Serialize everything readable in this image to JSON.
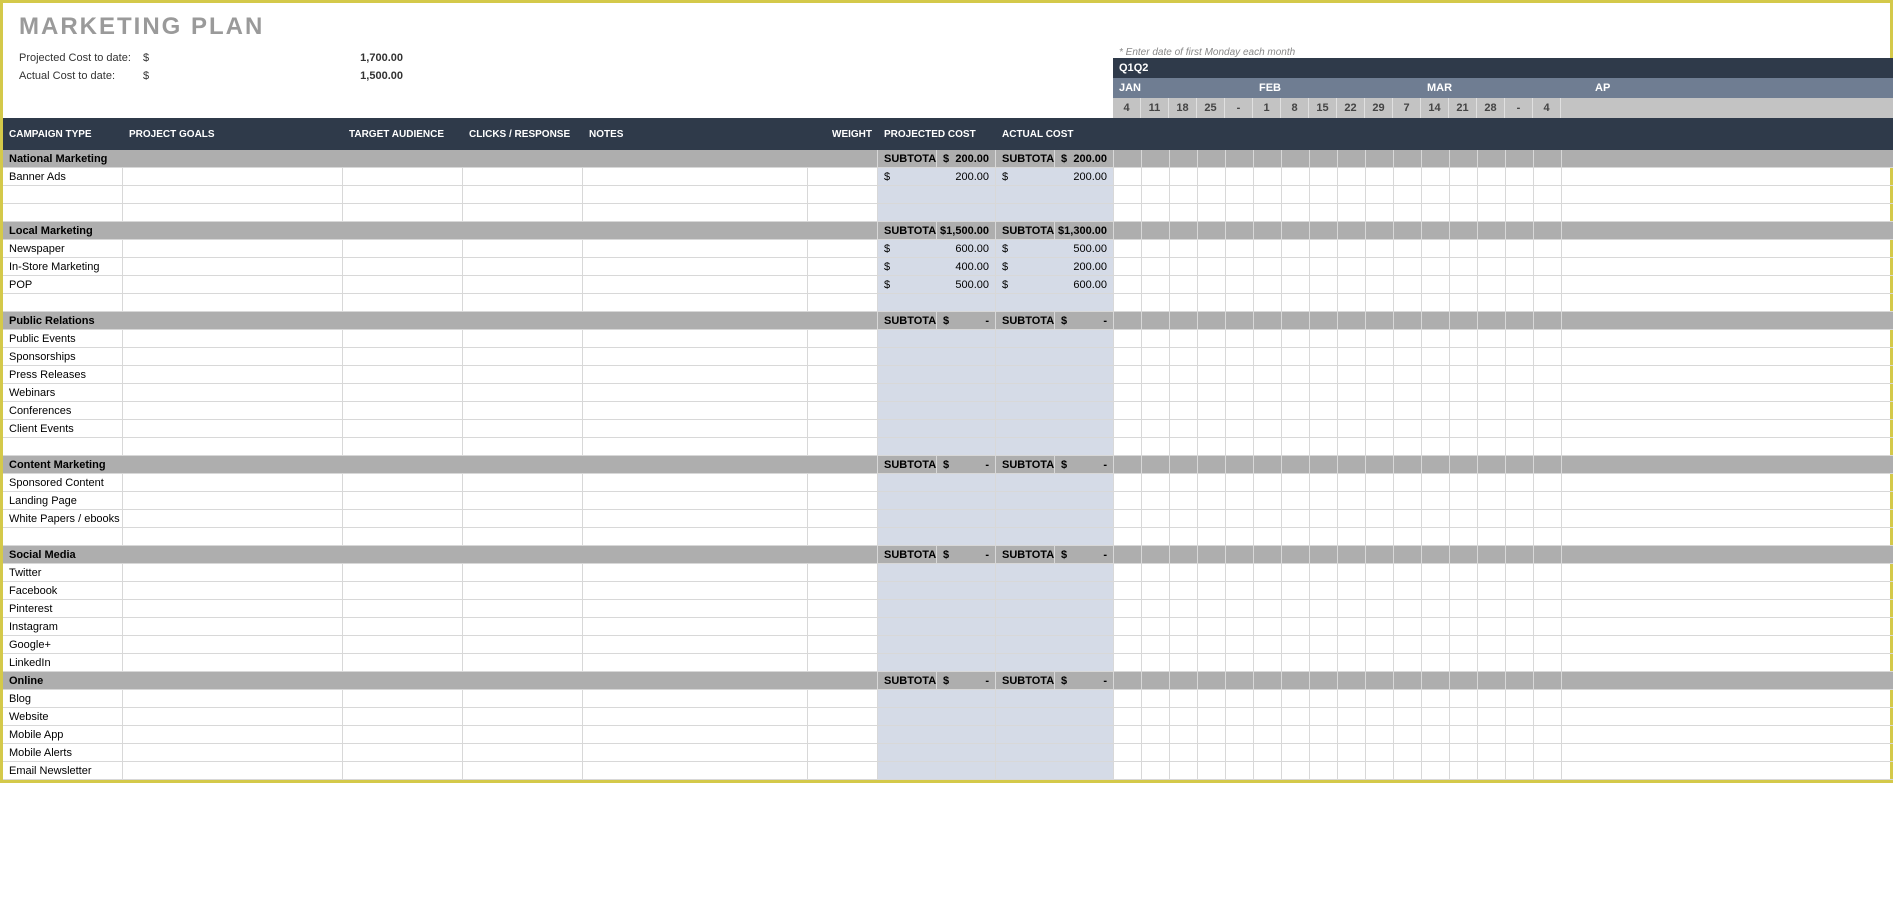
{
  "title": "MARKETING PLAN",
  "summary": {
    "proj_label": "Projected Cost to date:",
    "proj_cur": "$",
    "proj_val": "1,700.00",
    "act_label": "Actual Cost to date:",
    "act_cur": "$",
    "act_val": "1,500.00"
  },
  "calendar": {
    "hint": "* Enter date of first Monday each month",
    "quarter": "Q1",
    "quarter_end": "Q2",
    "months": [
      "JAN",
      "FEB",
      "MAR",
      "AP"
    ],
    "month_widths": [
      140,
      168,
      168,
      50
    ],
    "days": [
      "4",
      "11",
      "18",
      "25",
      "-",
      "1",
      "8",
      "15",
      "22",
      "29",
      "7",
      "14",
      "21",
      "28",
      "-",
      "4"
    ]
  },
  "headers": {
    "campaign": "CAMPAIGN TYPE",
    "goals": "PROJECT GOALS",
    "audience": "TARGET AUDIENCE",
    "clicks": "CLICKS / RESPONSE",
    "notes": "NOTES",
    "weight": "WEIGHT",
    "proj_cost": "PROJECTED COST",
    "act_cost": "ACTUAL COST",
    "subtotal": "SUBTOTAL"
  },
  "sections": [
    {
      "name": "National Marketing",
      "sub_proj": "$   200.00",
      "sub_act": "$   200.00",
      "rows": [
        {
          "name": "Banner Ads",
          "proj": "$   200.00",
          "act": "$   200.00"
        },
        {
          "name": ""
        },
        {
          "name": ""
        }
      ]
    },
    {
      "name": "Local Marketing",
      "sub_proj": "$  1,500.00",
      "sub_act": "$  1,300.00",
      "rows": [
        {
          "name": "Newspaper",
          "proj": "$   600.00",
          "act": "$   500.00"
        },
        {
          "name": "In-Store Marketing",
          "proj": "$   400.00",
          "act": "$   200.00"
        },
        {
          "name": "POP",
          "proj": "$   500.00",
          "act": "$   600.00"
        },
        {
          "name": ""
        }
      ]
    },
    {
      "name": "Public Relations",
      "sub_proj": "$           -",
      "sub_act": "$           -",
      "rows": [
        {
          "name": "Public Events"
        },
        {
          "name": "Sponsorships"
        },
        {
          "name": "Press Releases"
        },
        {
          "name": "Webinars"
        },
        {
          "name": "Conferences"
        },
        {
          "name": "Client Events"
        },
        {
          "name": ""
        }
      ]
    },
    {
      "name": "Content Marketing",
      "sub_proj": "$           -",
      "sub_act": "$           -",
      "rows": [
        {
          "name": "Sponsored Content"
        },
        {
          "name": "Landing Page"
        },
        {
          "name": "White Papers / ebooks"
        },
        {
          "name": ""
        }
      ]
    },
    {
      "name": "Social Media",
      "sub_proj": "$           -",
      "sub_act": "$           -",
      "rows": [
        {
          "name": "Twitter"
        },
        {
          "name": "Facebook"
        },
        {
          "name": "Pinterest"
        },
        {
          "name": "Instagram"
        },
        {
          "name": "Google+"
        },
        {
          "name": "LinkedIn"
        }
      ]
    },
    {
      "name": "Online",
      "sub_proj": "$           -",
      "sub_act": "$           -",
      "rows": [
        {
          "name": "Blog"
        },
        {
          "name": "Website"
        },
        {
          "name": "Mobile App"
        },
        {
          "name": "Mobile Alerts"
        },
        {
          "name": "Email Newsletter"
        }
      ]
    }
  ]
}
